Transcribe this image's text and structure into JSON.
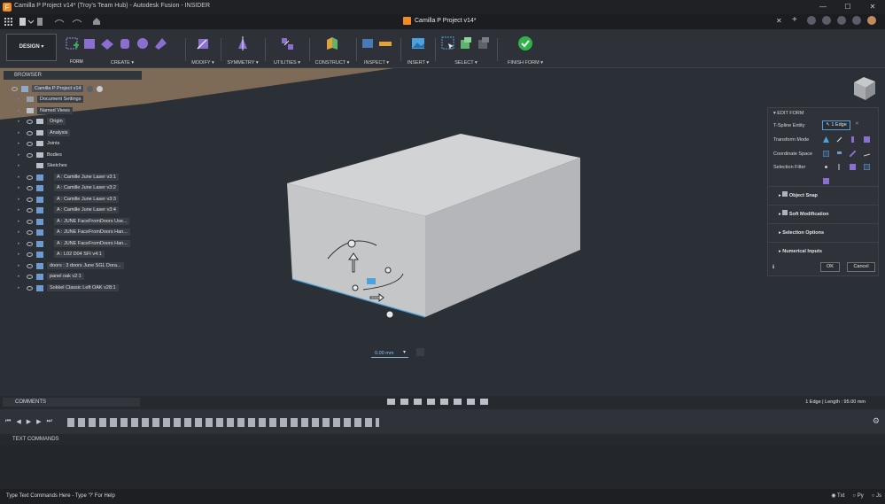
{
  "window": {
    "title": "Camilla P Project v14* (Troy's Team Hub) - Autodesk Fusion - INSIDER",
    "controls": [
      "—",
      "☐",
      "✕"
    ]
  },
  "document_tab": {
    "label": "Camilla P Project v14*"
  },
  "workspace": {
    "label": "DESIGN ▾"
  },
  "toolbar": {
    "form_label": "FORM",
    "groups": [
      {
        "label": "CREATE ▾"
      },
      {
        "label": "MODIFY ▾"
      },
      {
        "label": "SYMMETRY ▾"
      },
      {
        "label": "UTILITIES ▾"
      },
      {
        "label": "CONSTRUCT ▾"
      },
      {
        "label": "INSPECT ▾"
      },
      {
        "label": "INSERT ▾"
      },
      {
        "label": "SELECT ▾"
      },
      {
        "label": "FINISH FORM ▾"
      }
    ]
  },
  "browser": {
    "header": "BROWSER",
    "root": "Camilla P Project v14",
    "items": [
      "Document Settings",
      "Named Views",
      "Origin",
      "Analysis",
      "Joints",
      "Bodies",
      "Sketches",
      "A : Camille June Laser v3:1",
      "A : Camille June Laser v3:2",
      "A : Camille June Laser v3:3",
      "A : Camille June Laser v3:4",
      "A : JUNE FaceFromDoors Use...",
      "A : JUNE FaceFromDoors Han...",
      "A : JUNE FaceFromDoors Han...",
      "A : L02 D04 SFI v4:1",
      "doors : 3 doors June SGL Dora...",
      "panel oak v2:1",
      "Sokkel Classic Left OAK v28:1"
    ]
  },
  "edit_form": {
    "title": "EDIT FORM",
    "tspline_label": "T-Spline Entity",
    "tspline_value": "1 Edge",
    "transform_mode": "Transform Mode",
    "coordinate_space": "Coordinate Space",
    "selection_filter": "Selection Filter",
    "sections": [
      "Object Snap",
      "Soft Modification",
      "Selection Options",
      "Numerical Inputs"
    ],
    "ok": "OK",
    "cancel": "Cancel"
  },
  "dimension_input": "0.00 mm",
  "bottom": {
    "comments": "COMMENTS",
    "status": "1 Edge | Length : 95.00 mm"
  },
  "text_commands": {
    "header": "TEXT COMMANDS",
    "prompt": "Type Text Commands Here - Type '?' For Help",
    "modes": [
      "Txt",
      "Py",
      "Js"
    ]
  },
  "colors": {
    "accent": "#4aa3df",
    "finish_green": "#2db34a",
    "form_purple": "#8a6fd1"
  }
}
